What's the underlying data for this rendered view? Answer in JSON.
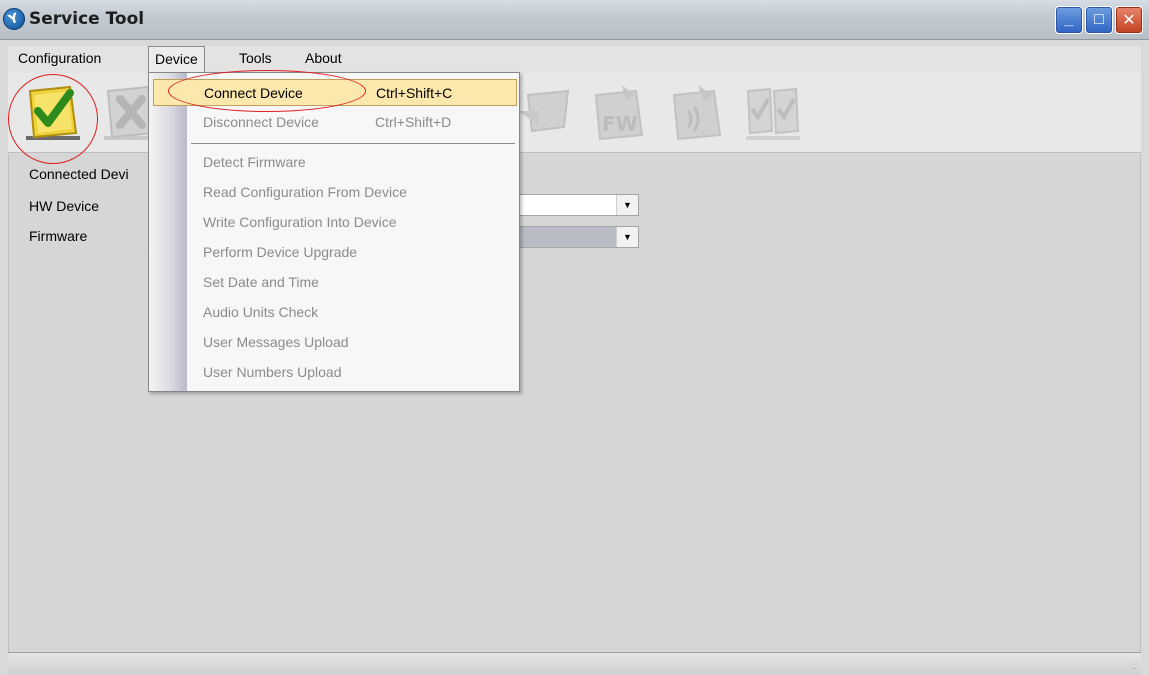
{
  "window": {
    "title": "Service Tool",
    "app_icon_glyph": "Y",
    "minimize_glyph": "_",
    "maximize_glyph": "□",
    "close_glyph": "✕"
  },
  "menubar": {
    "items": [
      {
        "label": "Configuration"
      },
      {
        "label": "Device"
      },
      {
        "label": "Tools"
      },
      {
        "label": "About"
      }
    ]
  },
  "toolbar": {
    "icons": [
      {
        "name": "connect-device-icon",
        "enabled": true
      },
      {
        "name": "disconnect-device-icon",
        "enabled": false
      },
      {
        "name": "read-configuration-icon",
        "enabled": false
      },
      {
        "name": "write-configuration-icon",
        "enabled": false
      },
      {
        "name": "firmware-upgrade-icon",
        "enabled": false,
        "label": "FW"
      },
      {
        "name": "audio-check-icon",
        "enabled": false
      },
      {
        "name": "user-upload-icon",
        "enabled": false
      }
    ]
  },
  "form": {
    "connected_device_label": "Connected Devi",
    "hw_device_label": "HW Device",
    "firmware_label": "Firmware",
    "dropdown_arrow": "▼"
  },
  "device_menu": {
    "items": [
      {
        "label": "Connect Device",
        "shortcut": "Ctrl+Shift+C",
        "enabled": true,
        "highlighted": true
      },
      {
        "label": "Disconnect Device",
        "shortcut": "Ctrl+Shift+D",
        "enabled": false
      },
      {
        "label": "Detect Firmware",
        "enabled": false
      },
      {
        "label": "Read Configuration From Device",
        "enabled": false
      },
      {
        "label": "Write Configuration Into Device",
        "enabled": false
      },
      {
        "label": "Perform Device Upgrade",
        "enabled": false
      },
      {
        "label": "Set Date and Time",
        "enabled": false
      },
      {
        "label": "Audio Units Check",
        "enabled": false
      },
      {
        "label": "User Messages Upload",
        "enabled": false
      },
      {
        "label": "User Numbers Upload",
        "enabled": false
      }
    ]
  },
  "statusbar": {
    "grip_glyph": ".:"
  },
  "colors": {
    "annotation_red": "#e01f1f",
    "highlight": "#fce8ad"
  }
}
